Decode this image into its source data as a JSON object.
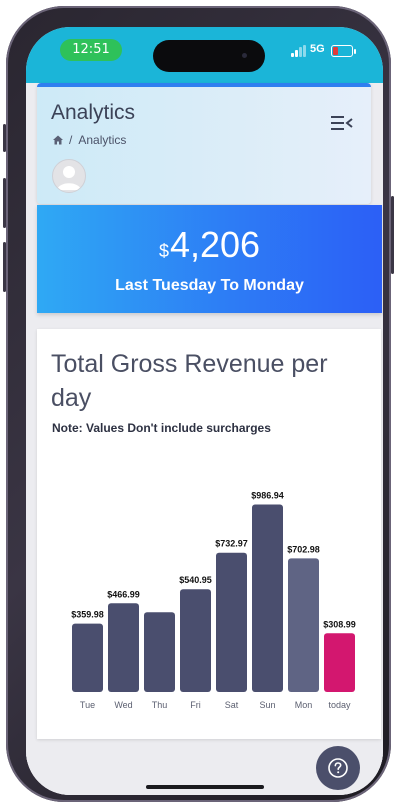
{
  "status_bar": {
    "time": "12:51",
    "network": "5G"
  },
  "header": {
    "title": "Analytics",
    "breadcrumb": "Analytics",
    "menu_icon": "menu-collapse-icon",
    "avatar_icon": "user-avatar-icon"
  },
  "revenue": {
    "currency": "$",
    "amount": "4,206",
    "period": "Last Tuesday To Monday"
  },
  "chart_card": {
    "title": "Total Gross Revenue per day",
    "note": "Note: Values Don't include surcharges"
  },
  "chart_data": {
    "type": "bar",
    "categories": [
      "Tue",
      "Wed",
      "Thu",
      "Fri",
      "Sat",
      "Sun",
      "Mon",
      "today"
    ],
    "values": [
      359.98,
      466.99,
      420,
      540.95,
      732.97,
      986.94,
      702.98,
      308.99
    ],
    "data_labels": [
      "$359.98",
      "$466.99",
      "",
      "$540.95",
      "$732.97",
      "$986.94",
      "$702.98",
      "$308.99"
    ],
    "colors": [
      "#4a4e6e",
      "#4a4e6e",
      "#4a4e6e",
      "#4a4e6e",
      "#4a4e6e",
      "#4a4e6e",
      "#5f6484",
      "#d3176f"
    ],
    "title": "",
    "xlabel": "",
    "ylabel": "",
    "ylim": [
      0,
      1000
    ],
    "grid": false,
    "legend": "none"
  },
  "help_button": {
    "icon": "question-circle-icon"
  }
}
